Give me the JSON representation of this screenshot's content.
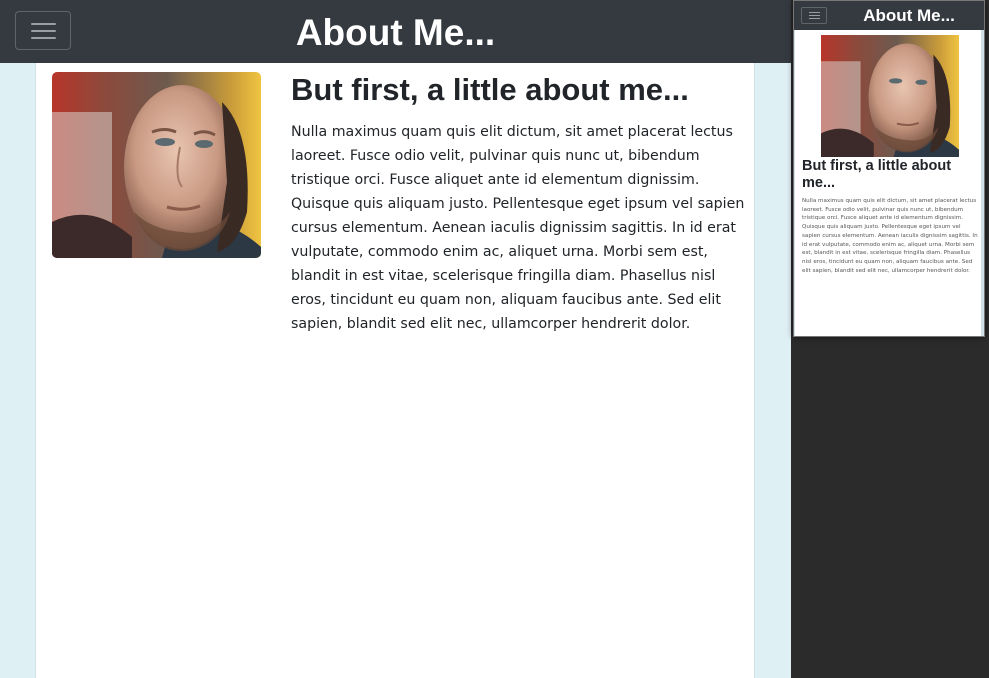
{
  "navbar": {
    "brand": "About Me...",
    "toggle_icon": "hamburger-menu-icon"
  },
  "content": {
    "portrait_alt": "portrait",
    "heading": "But first, a little about me...",
    "paragraph": "Nulla maximus quam quis elit dictum, sit amet placerat lectus laoreet. Fusce odio velit, pulvinar quis nunc ut, bibendum tristique orci. Fusce aliquet ante id elementum dignissim. Quisque quis aliquam justo. Pellentesque eget ipsum vel sapien cursus elementum. Aenean iaculis dignissim sagittis. In id erat vulputate, commodo enim ac, aliquet urna. Morbi sem est, blandit in est vitae, scelerisque fringilla diam. Phasellus nisl eros, tincidunt eu quam non, aliquam faucibus ante. Sed elit sapien, blandit sed elit nec, ullamcorper hendrerit dolor."
  },
  "colors": {
    "navbar": "#343a40",
    "page_background": "#dff0f5",
    "container": "#ffffff",
    "text": "#212529",
    "outer_background": "#2b2b2b"
  }
}
